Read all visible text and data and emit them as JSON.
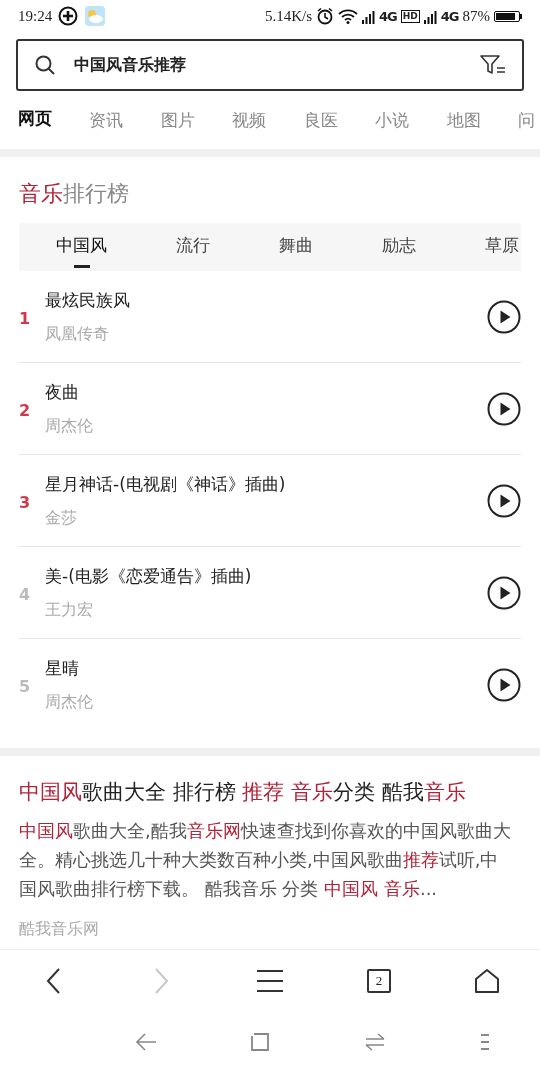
{
  "status_bar": {
    "time": "19:24",
    "speed": "5.14K/s",
    "network_1": "4G",
    "hd": "HD",
    "network_2": "4G",
    "battery": "87%"
  },
  "search": {
    "value": "中国风音乐推荐"
  },
  "tabs": [
    {
      "label": "网页",
      "selected": true
    },
    {
      "label": "资讯",
      "selected": false
    },
    {
      "label": "图片",
      "selected": false
    },
    {
      "label": "视频",
      "selected": false
    },
    {
      "label": "良医",
      "selected": false
    },
    {
      "label": "小说",
      "selected": false
    },
    {
      "label": "地图",
      "selected": false
    },
    {
      "label": "问",
      "selected": false
    }
  ],
  "chart_card": {
    "title": [
      {
        "text": "音乐",
        "highlight": true
      },
      {
        "text": "排行榜",
        "highlight": false
      }
    ],
    "tabs": [
      {
        "label": "中国风",
        "selected": true
      },
      {
        "label": "流行",
        "selected": false
      },
      {
        "label": "舞曲",
        "selected": false
      },
      {
        "label": "励志",
        "selected": false
      },
      {
        "label": "草原",
        "selected": false
      }
    ],
    "songs": [
      {
        "rank": "1",
        "top": true,
        "title": "最炫民族风",
        "artist": "凤凰传奇"
      },
      {
        "rank": "2",
        "top": true,
        "title": "夜曲",
        "artist": "周杰伦"
      },
      {
        "rank": "3",
        "top": true,
        "title": "星月神话-(电视剧《神话》插曲)",
        "artist": "金莎"
      },
      {
        "rank": "4",
        "top": false,
        "title": "美-(电影《恋爱通告》插曲)",
        "artist": "王力宏"
      },
      {
        "rank": "5",
        "top": false,
        "title": "星晴",
        "artist": "周杰伦"
      }
    ]
  },
  "result": {
    "title": [
      {
        "text": "中国风",
        "highlight": true
      },
      {
        "text": "歌曲大全 排行榜 ",
        "highlight": false
      },
      {
        "text": "推荐 音乐",
        "highlight": true
      },
      {
        "text": "分类 酷我",
        "highlight": false
      },
      {
        "text": "音乐",
        "highlight": true
      }
    ],
    "snippet": [
      {
        "text": "中国风",
        "highlight": true
      },
      {
        "text": "歌曲大全,酷我",
        "highlight": false
      },
      {
        "text": "音乐网",
        "highlight": true
      },
      {
        "text": "快速查找到你喜欢的中国风歌曲大全。精心挑选几十种大类数百种小类,中国风歌曲",
        "highlight": false
      },
      {
        "text": "推荐",
        "highlight": true
      },
      {
        "text": "试听,中国风歌曲排行榜下载。 酷我音乐 分类 ",
        "highlight": false
      },
      {
        "text": "中国风 音乐",
        "highlight": true
      },
      {
        "text": "...",
        "highlight": false
      }
    ],
    "source": "酷我音乐网"
  },
  "bottom_bar": {
    "back_enabled": true,
    "forward_enabled": false,
    "tab_count": "2"
  }
}
